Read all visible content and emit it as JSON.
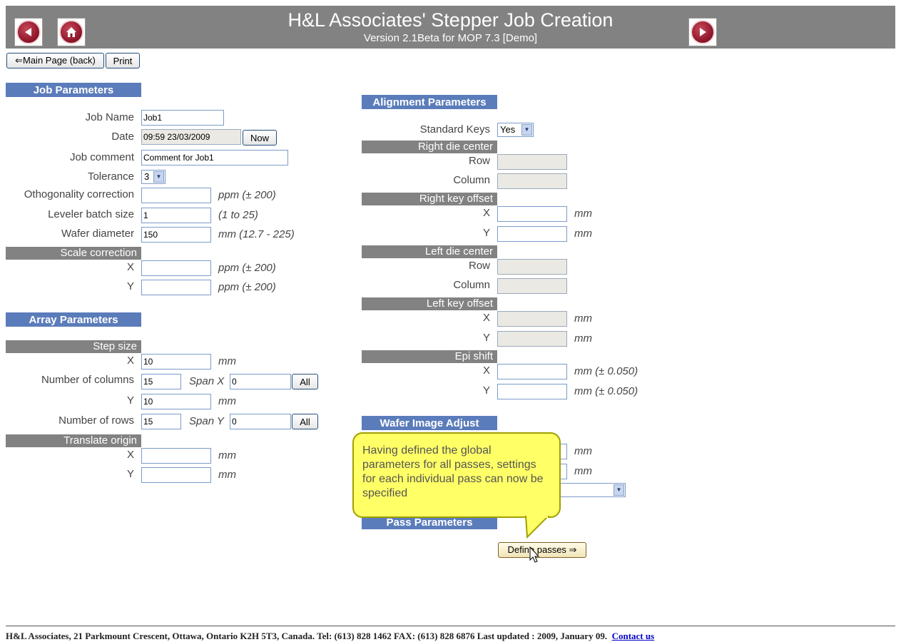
{
  "header": {
    "title": "H&L Associates' Stepper Job Creation",
    "subtitle": "Version 2.1Beta for MOP 7.3   [Demo]",
    "back_icon": "back-arrow-icon",
    "home_icon": "home-icon",
    "next_icon": "forward-arrow-icon"
  },
  "toolbar": {
    "main_page": "⇐Main Page (back)",
    "print": "Print"
  },
  "job": {
    "heading": "Job Parameters",
    "job_name_label": "Job Name",
    "job_name": "Job1",
    "date_label": "Date",
    "date": "09:59 23/03/2009",
    "now": "Now",
    "comment_label": "Job comment",
    "comment": "Comment for Job1",
    "tolerance_label": "Tolerance",
    "tolerance": "3",
    "ortho_label": "Othogonality correction",
    "ortho_unit": "ppm (± 200)",
    "leveler_label": "Leveler batch size",
    "leveler": "1",
    "leveler_unit": "(1 to 25)",
    "wafer_label": "Wafer diameter",
    "wafer": "150",
    "wafer_unit": "mm (12.7 - 225)",
    "scale_heading": "Scale correction",
    "x": "X",
    "y": "Y",
    "scale_unit": "ppm (± 200)"
  },
  "array": {
    "heading": "Array Parameters",
    "step_heading": "Step size",
    "x": "X",
    "y": "Y",
    "mm": "mm",
    "step_x": "10",
    "step_y": "10",
    "cols_label": "Number of columns",
    "cols": "15",
    "span_x_label": "Span X",
    "span_x": "0",
    "rows_label": "Number of rows",
    "rows": "15",
    "span_y_label": "Span Y",
    "span_y": "0",
    "all": "All",
    "translate_heading": "Translate origin"
  },
  "align": {
    "heading": "Alignment Parameters",
    "std_keys_label": "Standard Keys",
    "std_keys": "Yes",
    "rdc_heading": "Right die center",
    "row": "Row",
    "column": "Column",
    "rko_heading": "Right key offset",
    "ldc_heading": "Left die center",
    "lko_heading": "Left key offset",
    "epi_heading": "Epi shift",
    "x": "X",
    "y": "Y",
    "mm": "mm",
    "epi_unit": "mm (± 0.050)"
  },
  "wafer_image": {
    "heading": "Wafer Image Adjust",
    "mm": "mm"
  },
  "pass": {
    "heading": "Pass Parameters",
    "define": "Define passes ⇒"
  },
  "callout": "Having defined the global parameters for all passes, settings for each individual pass can now be specified",
  "footer": {
    "text": "H&L Associates, 21 Parkmount Crescent, Ottawa, Ontario K2H 5T3, Canada. Tel: (613) 828 1462   FAX: (613) 828 6876     Last updated : 2009, January 09.",
    "contact": "Contact us"
  }
}
